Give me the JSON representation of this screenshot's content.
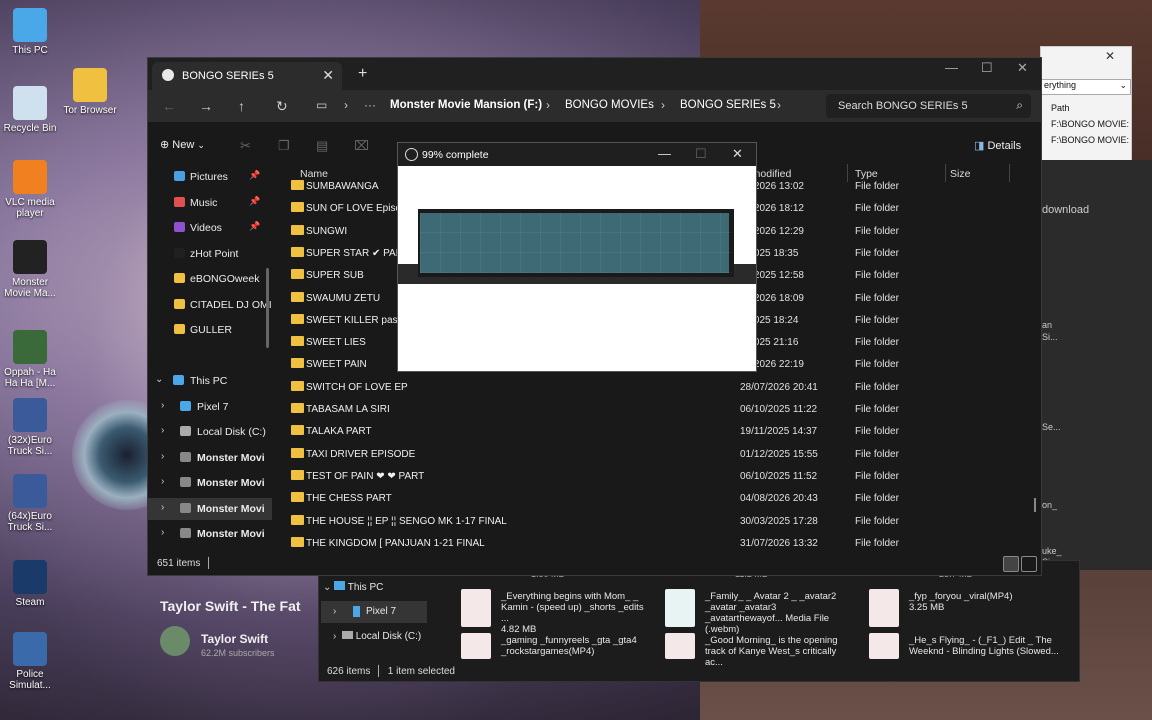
{
  "desktop": {
    "icons": [
      {
        "label": "This PC",
        "icon": "this-pc-icon",
        "color": "#4aa8e8"
      },
      {
        "label": "Tor Browser",
        "icon": "tor-browser-icon",
        "color": "#f0c040"
      },
      {
        "label": "Recycle Bin",
        "icon": "recycle-bin-icon",
        "color": "#cfe0ef"
      },
      {
        "label": "VLC media player",
        "icon": "vlc-icon",
        "color": "#f08020"
      },
      {
        "label": "Monster Movie Ma...",
        "icon": "gear-icon",
        "color": "#222222"
      },
      {
        "label": "Oppah - Ha Ha Ha [M...",
        "icon": "video-file-icon",
        "color": "#3a6a3a"
      },
      {
        "label": "(32x)Euro Truck Si...",
        "icon": "truck-icon",
        "color": "#3a5a9a"
      },
      {
        "label": "(64x)Euro Truck Si...",
        "icon": "truck-icon",
        "color": "#3a5a9a"
      },
      {
        "label": "Steam",
        "icon": "steam-icon",
        "color": "#1a3a6a"
      },
      {
        "label": "Police Simulat...",
        "icon": "police-icon",
        "color": "#3a6aaa"
      }
    ]
  },
  "window": {
    "tab_title": "BONGO SERIEs 5",
    "breadcrumbs": [
      "Monster Movie Mansion (F:)",
      "BONGO MOVIEs",
      "BONGO SERIEs 5"
    ],
    "search_placeholder": "Search BONGO SERIEs 5",
    "toolbar": {
      "new_label": "New",
      "details_label": "Details"
    },
    "nav_items": [
      {
        "label": "Pictures",
        "pinned": true,
        "icon": "pictures-icon",
        "color": "#4aa0e0"
      },
      {
        "label": "Music",
        "pinned": true,
        "icon": "music-icon",
        "color": "#e05050"
      },
      {
        "label": "Videos",
        "pinned": true,
        "icon": "videos-icon",
        "color": "#9050d0"
      },
      {
        "label": "zHot Point",
        "pinned": false,
        "icon": "folder-icon",
        "color": "#202020"
      },
      {
        "label": "eBONGOweek",
        "pinned": false,
        "icon": "folder-icon",
        "color": "#f0c040"
      },
      {
        "label": "CITADEL DJ OMI",
        "pinned": false,
        "icon": "folder-icon",
        "color": "#f0c040"
      },
      {
        "label": "GULLER",
        "pinned": false,
        "icon": "folder-icon",
        "color": "#f0c040"
      }
    ],
    "tree_items": [
      {
        "label": "This PC",
        "icon": "this-pc-icon",
        "color": "#4aa8e8",
        "expanded": true
      },
      {
        "label": "Pixel 7",
        "icon": "phone-icon",
        "color": "#4aa8e8"
      },
      {
        "label": "Local Disk (C:)",
        "icon": "drive-icon",
        "color": "#aaaaaa"
      },
      {
        "label": "Monster Movi",
        "icon": "drive-icon",
        "color": "#888888"
      },
      {
        "label": "Monster Movi",
        "icon": "drive-icon",
        "color": "#888888"
      },
      {
        "label": "Monster Movi",
        "icon": "drive-icon",
        "color": "#888888",
        "selected": true
      },
      {
        "label": "Monster Movi",
        "icon": "drive-icon",
        "color": "#888888"
      }
    ],
    "columns": {
      "name": "Name",
      "modified": "te modified",
      "type": "Type",
      "size": "Size"
    },
    "rows": [
      {
        "name": "SUMBAWANGA",
        "date": "08/2026 13:02",
        "type": "File folder"
      },
      {
        "name": "SUN OF LOVE Episode",
        "date": "02/2026 18:12",
        "type": "File folder"
      },
      {
        "name": "SUNGWI",
        "date": "03/2026 12:29",
        "type": "File folder"
      },
      {
        "name": "SUPER STAR ✔ PART",
        "date": "2/2025 18:35",
        "type": "File folder"
      },
      {
        "name": "SUPER SUB",
        "date": "10/2025 12:58",
        "type": "File folder"
      },
      {
        "name": "SWAUMU ZETU",
        "date": "03/2026 18:09",
        "type": "File folder"
      },
      {
        "name": "SWEET KILLER pasarb",
        "date": "1/2025 18:24",
        "type": "File folder"
      },
      {
        "name": "SWEET LIES",
        "date": "2/2025 21:16",
        "type": "File folder"
      },
      {
        "name": "SWEET PAIN",
        "date": "07/2026 22:19",
        "type": "File folder"
      },
      {
        "name": "SWITCH OF LOVE EP",
        "date": "28/07/2026 20:41",
        "type": "File folder"
      },
      {
        "name": "TABASAM LA SIRI",
        "date": "06/10/2025 11:22",
        "type": "File folder"
      },
      {
        "name": "TALAKA PART",
        "date": "19/11/2025 14:37",
        "type": "File folder"
      },
      {
        "name": "TAXI DRIVER EPISODE",
        "date": "01/12/2025 15:55",
        "type": "File folder"
      },
      {
        "name": "TEST OF PAIN ❤ ❤ PART",
        "date": "06/10/2025 11:52",
        "type": "File folder"
      },
      {
        "name": "THE CHESS PART",
        "date": "04/08/2026 20:43",
        "type": "File folder"
      },
      {
        "name": "THE HOUSE ¦¦ EP ¦¦ SENGO MK 1-17 FINAL",
        "date": "30/03/2025 17:28",
        "type": "File folder"
      },
      {
        "name": "THE KINGDOM [       PANJUAN 1-21 FINAL",
        "date": "31/07/2026 13:32",
        "type": "File folder"
      }
    ],
    "status": "651 items"
  },
  "progress_dialog": {
    "title": "99% complete",
    "percent": 99,
    "fill_color": "#3d6a75"
  },
  "back_window": {
    "tree": [
      {
        "label": "This PC",
        "icon": "this-pc-icon"
      },
      {
        "label": "Pixel 7",
        "icon": "phone-icon",
        "selected": true
      },
      {
        "label": "Local Disk (C:)",
        "icon": "drive-icon"
      }
    ],
    "status": "626 items",
    "selected": "1 item selected",
    "top_sizes": [
      "1.80 MB",
      "11.2 MB",
      "25.7 MB"
    ],
    "files": [
      {
        "title": "_Everything begins with Mom_ _ Kamin - (speed up) _shorts _edits ...",
        "size": "4.82 MB",
        "icon": "video-file-icon"
      },
      {
        "title": "_Family_ _ Avatar 2 _ _avatar2 _avatar _avatar3 _avatarthewayof... Media File (.webm)",
        "size": "",
        "icon": "media-file-icon"
      },
      {
        "title": "_fyp _foryou _viral(MP4)",
        "size": "3.25 MB",
        "icon": "video-file-icon"
      },
      {
        "title": "_gaming _funnyreels _gta _gta4 _rockstargames(MP4)",
        "size": "",
        "icon": "video-file-icon"
      },
      {
        "title": "_Good Morning_ is the opening track of Kanye West_s critically ac...",
        "size": "",
        "icon": "video-file-icon"
      },
      {
        "title": "_He_s Flying_ - (_F1_) Edit _ The Weeknd - Blinding Lights (Slowed...",
        "size": "",
        "icon": "video-file-icon"
      }
    ]
  },
  "right_window": {
    "dropdown": "erything",
    "col": "Path",
    "paths": [
      "F:\\BONGO MOVIE:",
      "F:\\BONGO MOVIE:"
    ],
    "download": "download",
    "side_texts": [
      "an",
      "Si...",
      "Se...",
      "on_",
      "uke_",
      "Si..."
    ]
  },
  "youtube": {
    "title": "Taylor Swift - The Fat",
    "channel": "Taylor Swift",
    "subs": "62.2M subscribers"
  }
}
